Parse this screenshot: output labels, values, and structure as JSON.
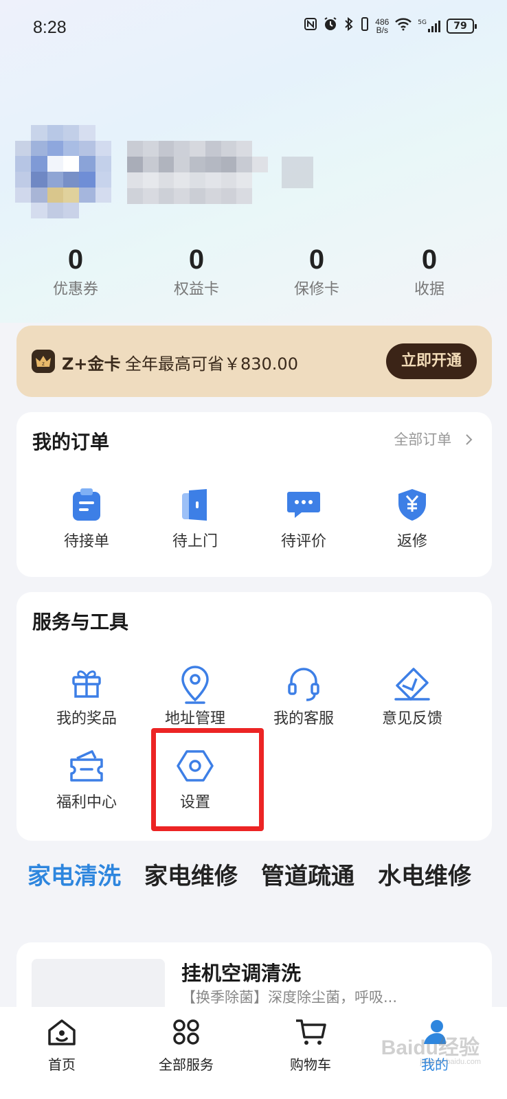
{
  "status_bar": {
    "time": "8:28",
    "net_speed_value": "486",
    "net_speed_unit": "B/s",
    "network": "5G",
    "battery": "79",
    "icons": [
      "nfc-icon",
      "alarm-icon",
      "bluetooth-icon",
      "vibrate-icon",
      "wifi-icon",
      "signal-icon",
      "battery-icon"
    ]
  },
  "stats": [
    {
      "value": "0",
      "label": "优惠券"
    },
    {
      "value": "0",
      "label": "权益卡"
    },
    {
      "value": "0",
      "label": "保修卡"
    },
    {
      "value": "0",
      "label": "收据"
    }
  ],
  "gold_card": {
    "title": "Z+金卡",
    "desc": "全年最高可省￥830.00",
    "button": "立即开通",
    "icon_letter": "z"
  },
  "orders": {
    "title": "我的订单",
    "link": "全部订单",
    "items": [
      {
        "label": "待接单",
        "icon": "clipboard-icon"
      },
      {
        "label": "待上门",
        "icon": "door-icon"
      },
      {
        "label": "待评价",
        "icon": "chat-bubble-icon"
      },
      {
        "label": "返修",
        "icon": "yuan-shield-icon"
      }
    ]
  },
  "tools": {
    "title": "服务与工具",
    "items": [
      {
        "label": "我的奖品",
        "icon": "gift-icon"
      },
      {
        "label": "地址管理",
        "icon": "location-pin-icon"
      },
      {
        "label": "我的客服",
        "icon": "headset-icon"
      },
      {
        "label": "意见反馈",
        "icon": "feedback-icon"
      },
      {
        "label": "福利中心",
        "icon": "wallet-icon"
      },
      {
        "label": "设置",
        "icon": "settings-hexagon-icon"
      }
    ]
  },
  "category_tabs": [
    "家电清洗",
    "家电维修",
    "管道疏通",
    "水电维修"
  ],
  "active_tab_index": 0,
  "product": {
    "title": "挂机空调清洗",
    "desc": "【换季除菌】深度除尘菌，呼吸..."
  },
  "bottom_nav": [
    {
      "label": "首页",
      "icon": "home-icon"
    },
    {
      "label": "全部服务",
      "icon": "grid-icon"
    },
    {
      "label": "购物车",
      "icon": "cart-icon"
    },
    {
      "label": "我的",
      "icon": "profile-icon"
    }
  ],
  "watermark": {
    "text": "Baidu经验",
    "sub": "jingyan.baidu.com"
  },
  "colors": {
    "accent": "#2e86de",
    "icon_blue": "#3d7fe6",
    "gold_bg": "#efdcbf",
    "gold_btn": "#3b2417",
    "highlight": "#ec2424"
  }
}
